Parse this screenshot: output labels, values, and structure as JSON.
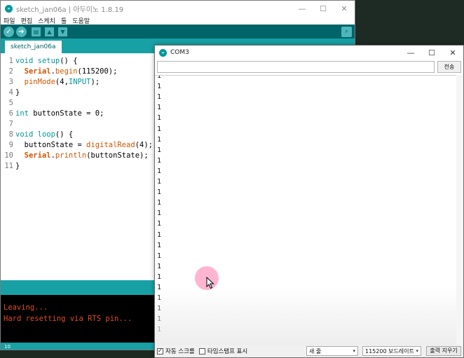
{
  "ide": {
    "title": "sketch_jan06a | 아두이노 1.8.19",
    "menu": [
      "파일",
      "편집",
      "스케치",
      "툴",
      "도움말"
    ],
    "tab_label": "sketch_jan06a",
    "code_lines": [
      {
        "n": "1",
        "tokens": [
          {
            "t": "void",
            "c": "kw"
          },
          {
            "t": " ",
            "c": "plain"
          },
          {
            "t": "setup",
            "c": "kw"
          },
          {
            "t": "() {",
            "c": "plain"
          }
        ]
      },
      {
        "n": "2",
        "tokens": [
          {
            "t": "  ",
            "c": "plain"
          },
          {
            "t": "Serial",
            "c": "kw-b"
          },
          {
            "t": ".",
            "c": "plain"
          },
          {
            "t": "begin",
            "c": "fn"
          },
          {
            "t": "(115200);",
            "c": "plain"
          }
        ]
      },
      {
        "n": "3",
        "tokens": [
          {
            "t": "  ",
            "c": "plain"
          },
          {
            "t": "pinMode",
            "c": "fn"
          },
          {
            "t": "(4,",
            "c": "plain"
          },
          {
            "t": "INPUT",
            "c": "const"
          },
          {
            "t": ");",
            "c": "plain"
          }
        ]
      },
      {
        "n": "4",
        "tokens": [
          {
            "t": "}",
            "c": "plain"
          }
        ]
      },
      {
        "n": "5",
        "tokens": []
      },
      {
        "n": "6",
        "tokens": [
          {
            "t": "int",
            "c": "kw"
          },
          {
            "t": " buttonState = 0;",
            "c": "plain"
          }
        ]
      },
      {
        "n": "7",
        "tokens": []
      },
      {
        "n": "8",
        "tokens": [
          {
            "t": "void",
            "c": "kw"
          },
          {
            "t": " ",
            "c": "plain"
          },
          {
            "t": "loop",
            "c": "kw"
          },
          {
            "t": "() {",
            "c": "plain"
          }
        ]
      },
      {
        "n": "9",
        "tokens": [
          {
            "t": "  buttonState = ",
            "c": "plain"
          },
          {
            "t": "digitalRead",
            "c": "fn"
          },
          {
            "t": "(4);",
            "c": "plain"
          }
        ]
      },
      {
        "n": "10",
        "tokens": [
          {
            "t": "  ",
            "c": "plain"
          },
          {
            "t": "Serial",
            "c": "kw-b"
          },
          {
            "t": ".",
            "c": "plain"
          },
          {
            "t": "println",
            "c": "fn"
          },
          {
            "t": "(buttonState);",
            "c": "plain"
          }
        ]
      },
      {
        "n": "11",
        "tokens": [
          {
            "t": "}",
            "c": "plain"
          }
        ]
      }
    ],
    "console_lines": [
      "Leaving...",
      "Hard resetting via RTS pin..."
    ],
    "footer_line": "10"
  },
  "serial_monitor": {
    "title": "COM3",
    "input_value": "",
    "send_label": "전송",
    "output_lines": [
      "1",
      "1",
      "1",
      "1",
      "1",
      "1",
      "1",
      "1",
      "1",
      "1",
      "1",
      "1",
      "1",
      "1",
      "1",
      "1",
      "1",
      "1",
      "1",
      "1",
      "1",
      "1",
      "1",
      "1",
      "1"
    ],
    "autoscroll": {
      "label": "자동 스크롤",
      "checked": true
    },
    "timestamp": {
      "label": "타임스탬프 표시",
      "checked": false
    },
    "line_ending": "새 줄",
    "baud_rate": "115200 보드레이트",
    "clear_label": "출력 지우기"
  },
  "colors": {
    "teal_dark": "#006468",
    "teal": "#17a1a5",
    "console_text": "#e34c22"
  }
}
